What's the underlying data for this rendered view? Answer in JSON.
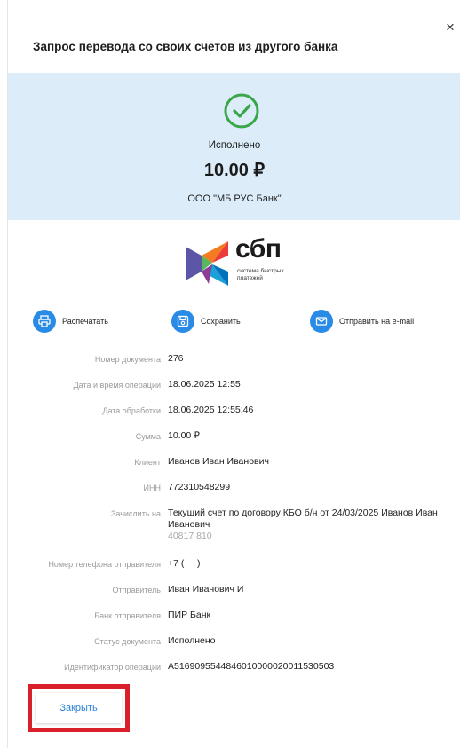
{
  "dialog": {
    "title": "Запрос перевода со своих счетов из другого банка",
    "close_symbol": "×"
  },
  "status": {
    "text": "Исполнено",
    "amount": "10.00 ₽",
    "bank": "ООО \"МБ РУС Банк\""
  },
  "logo": {
    "word": "сбп",
    "sub_line1": "система быстрых",
    "sub_line2": "платежей"
  },
  "actions": [
    {
      "label": "Распечатать",
      "icon": "printer-icon"
    },
    {
      "label": "Сохранить",
      "icon": "save-icon"
    },
    {
      "label": "Отправить на e-mail",
      "icon": "mail-icon"
    }
  ],
  "details": [
    {
      "key": "Номер документа",
      "value": "276"
    },
    {
      "key": "Дата и время операции",
      "value": "18.06.2025 12:55"
    },
    {
      "key": "Дата обработки",
      "value": "18.06.2025 12:55:46"
    },
    {
      "key": "Сумма",
      "value": "10.00 ₽"
    },
    {
      "key": "Клиент",
      "value": "Иванов Иван Иванович"
    },
    {
      "key": "ИНН",
      "value": "772310548299"
    },
    {
      "key": "Зачислить на",
      "value": "Текущий счет по договору КБО б/н от 24/03/2025 Иванов Иван Иванович",
      "sub": "40817 810"
    },
    {
      "key": "Номер телефона отправителя",
      "value": "+7 (     )"
    },
    {
      "key": "Отправитель",
      "value": "Иван Иванович И"
    },
    {
      "key": "Банк отправителя",
      "value": "ПИР Банк"
    },
    {
      "key": "Статус документа",
      "value": "Исполнено"
    },
    {
      "key": "Идентификатор операции",
      "value": "A5169095544846010000020011530503"
    }
  ],
  "footer": {
    "close_label": "Закрыть"
  },
  "colors": {
    "accent": "#2a8be6",
    "status_panel": "#dcedf9",
    "success": "#3aa64a",
    "highlight": "#d9202a"
  }
}
